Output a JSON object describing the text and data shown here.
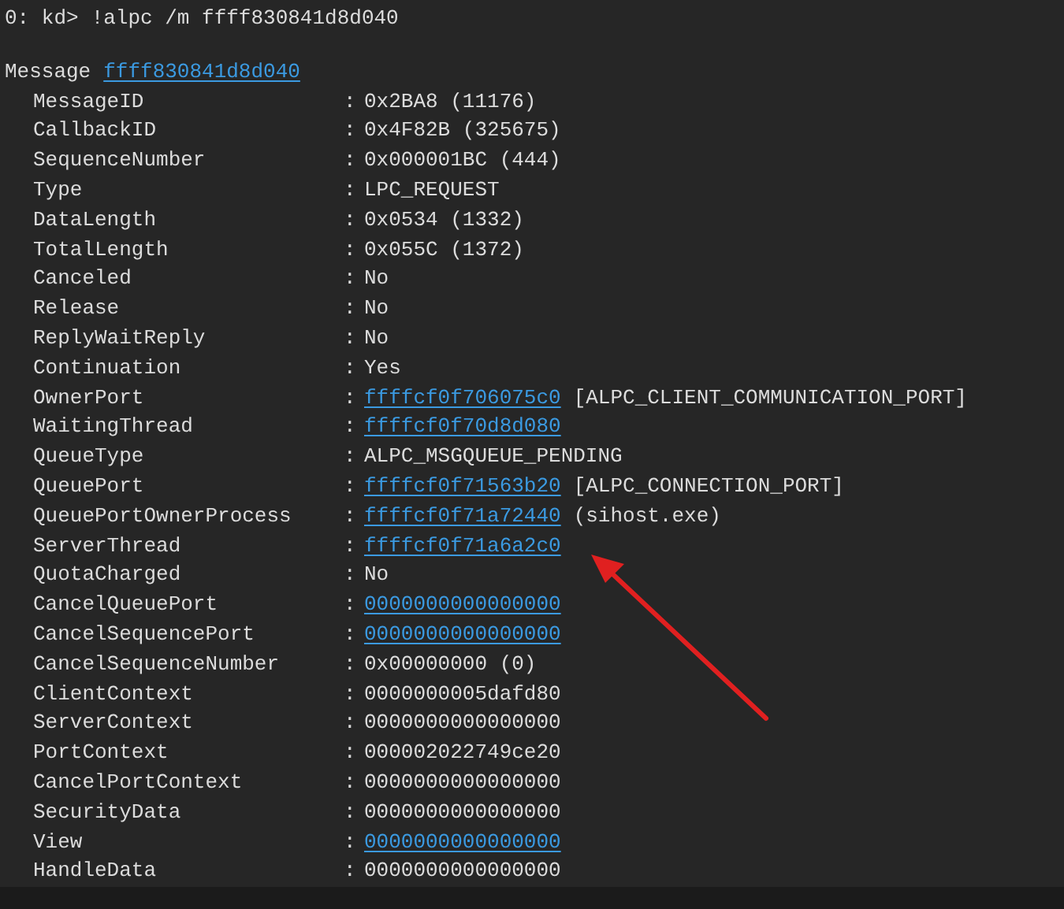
{
  "command": {
    "prompt": "0: kd>",
    "text": "!alpc /m ffff830841d8d040"
  },
  "message": {
    "label": "Message",
    "address": "ffff830841d8d040"
  },
  "fields": [
    {
      "label": "MessageID",
      "parts": [
        {
          "kind": "text",
          "text": "0x2BA8 (11176)"
        }
      ]
    },
    {
      "label": "CallbackID",
      "parts": [
        {
          "kind": "text",
          "text": "0x4F82B (325675)"
        }
      ]
    },
    {
      "label": "SequenceNumber",
      "parts": [
        {
          "kind": "text",
          "text": "0x000001BC (444)"
        }
      ]
    },
    {
      "label": "Type",
      "parts": [
        {
          "kind": "text",
          "text": "LPC_REQUEST"
        }
      ]
    },
    {
      "label": "DataLength",
      "parts": [
        {
          "kind": "text",
          "text": "0x0534 (1332)"
        }
      ]
    },
    {
      "label": "TotalLength",
      "parts": [
        {
          "kind": "text",
          "text": "0x055C (1372)"
        }
      ]
    },
    {
      "label": "Canceled",
      "parts": [
        {
          "kind": "text",
          "text": "No"
        }
      ]
    },
    {
      "label": "Release",
      "parts": [
        {
          "kind": "text",
          "text": "No"
        }
      ]
    },
    {
      "label": "ReplyWaitReply",
      "parts": [
        {
          "kind": "text",
          "text": "No"
        }
      ]
    },
    {
      "label": "Continuation",
      "parts": [
        {
          "kind": "text",
          "text": "Yes"
        }
      ]
    },
    {
      "label": "OwnerPort",
      "parts": [
        {
          "kind": "link",
          "text": "ffffcf0f706075c0"
        },
        {
          "kind": "text",
          "text": "[ALPC_CLIENT_COMMUNICATION_PORT]"
        }
      ]
    },
    {
      "label": "WaitingThread",
      "parts": [
        {
          "kind": "link",
          "text": "ffffcf0f70d8d080"
        }
      ]
    },
    {
      "label": "QueueType",
      "parts": [
        {
          "kind": "text",
          "text": "ALPC_MSGQUEUE_PENDING"
        }
      ]
    },
    {
      "label": "QueuePort",
      "parts": [
        {
          "kind": "link",
          "text": "ffffcf0f71563b20"
        },
        {
          "kind": "text",
          "text": "[ALPC_CONNECTION_PORT]"
        }
      ]
    },
    {
      "label": "QueuePortOwnerProcess",
      "parts": [
        {
          "kind": "link",
          "text": "ffffcf0f71a72440"
        },
        {
          "kind": "text",
          "text": "(sihost.exe)"
        }
      ]
    },
    {
      "label": "ServerThread",
      "parts": [
        {
          "kind": "link",
          "text": "ffffcf0f71a6a2c0"
        }
      ]
    },
    {
      "label": "QuotaCharged",
      "parts": [
        {
          "kind": "text",
          "text": "No"
        }
      ]
    },
    {
      "label": "CancelQueuePort",
      "parts": [
        {
          "kind": "link",
          "text": "0000000000000000"
        }
      ]
    },
    {
      "label": "CancelSequencePort",
      "parts": [
        {
          "kind": "link",
          "text": "0000000000000000"
        }
      ]
    },
    {
      "label": "CancelSequenceNumber",
      "parts": [
        {
          "kind": "text",
          "text": "0x00000000 (0)"
        }
      ]
    },
    {
      "label": "ClientContext",
      "parts": [
        {
          "kind": "text",
          "text": "0000000005dafd80"
        }
      ]
    },
    {
      "label": "ServerContext",
      "parts": [
        {
          "kind": "text",
          "text": "0000000000000000"
        }
      ]
    },
    {
      "label": "PortContext",
      "parts": [
        {
          "kind": "text",
          "text": "000002022749ce20"
        }
      ]
    },
    {
      "label": "CancelPortContext",
      "parts": [
        {
          "kind": "text",
          "text": "0000000000000000"
        }
      ]
    },
    {
      "label": "SecurityData",
      "parts": [
        {
          "kind": "text",
          "text": "0000000000000000"
        }
      ]
    },
    {
      "label": "View",
      "parts": [
        {
          "kind": "link",
          "text": "0000000000000000"
        }
      ]
    },
    {
      "label": "HandleData",
      "parts": [
        {
          "kind": "text",
          "text": "0000000000000000"
        }
      ]
    }
  ],
  "separator": ":"
}
